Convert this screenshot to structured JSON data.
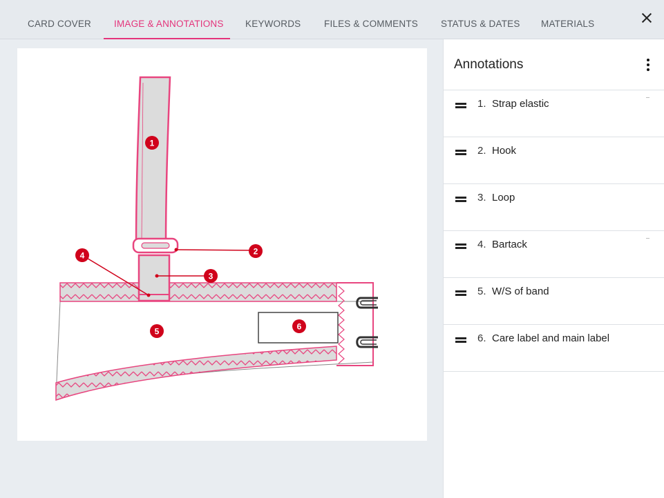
{
  "tabs": [
    {
      "label": "CARD COVER",
      "active": false
    },
    {
      "label": "IMAGE & ANNOTATIONS",
      "active": true
    },
    {
      "label": "KEYWORDS",
      "active": false
    },
    {
      "label": "FILES & COMMENTS",
      "active": false
    },
    {
      "label": "STATUS & DATES",
      "active": false
    },
    {
      "label": "MATERIALS",
      "active": false
    }
  ],
  "close_icon": "close-icon",
  "panel": {
    "title": "Annotations",
    "menu_icon": "more-vertical-icon"
  },
  "annotations": [
    {
      "number": "1.",
      "label": "Strap elastic"
    },
    {
      "number": "2.",
      "label": "Hook"
    },
    {
      "number": "3.",
      "label": "Loop"
    },
    {
      "number": "4.",
      "label": "Bartack"
    },
    {
      "number": "5.",
      "label": "W/S of band"
    },
    {
      "number": "6.",
      "label": "Care label and main label"
    }
  ],
  "markers": [
    "1",
    "2",
    "3",
    "4",
    "5",
    "6"
  ],
  "colors": {
    "accent": "#e4337a",
    "marker": "#d0021b",
    "line": "#e8457f",
    "fabric": "#dcdcdc"
  }
}
